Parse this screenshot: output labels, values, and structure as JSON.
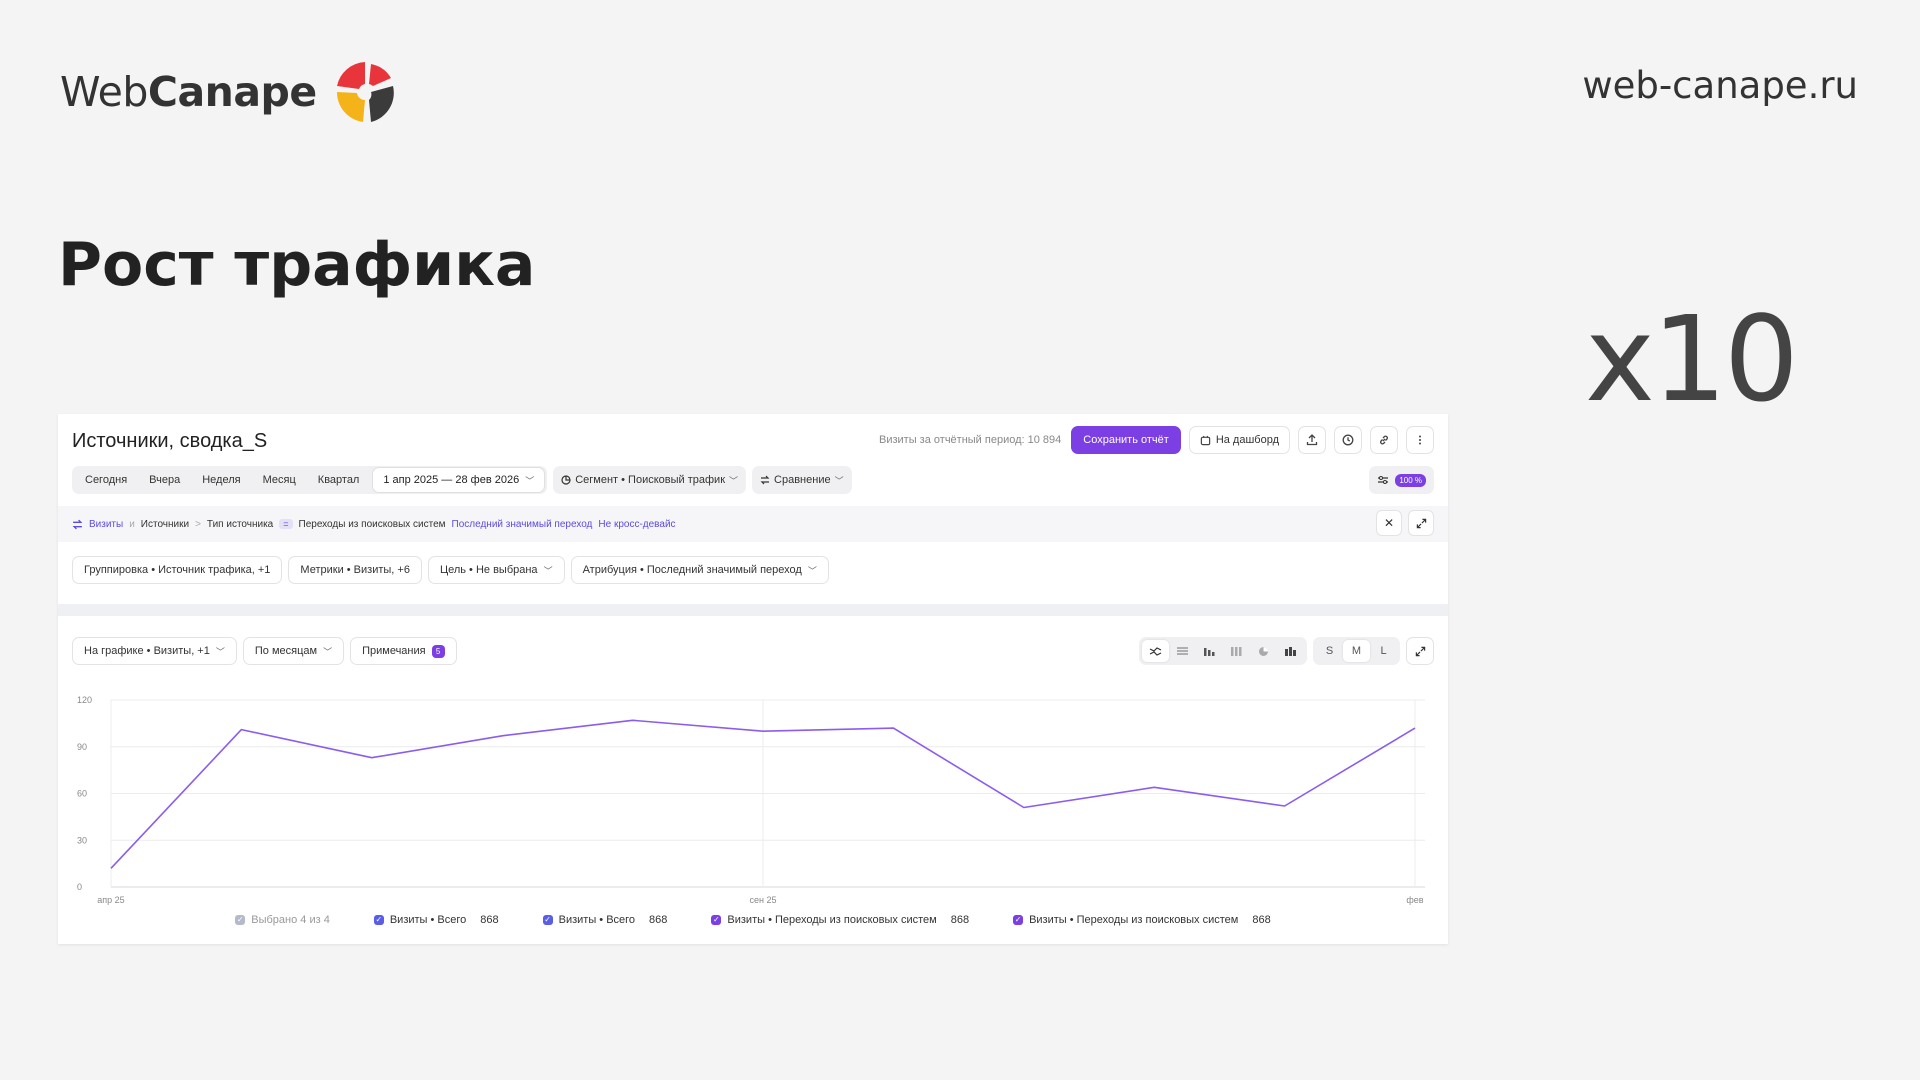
{
  "brand": {
    "name_thin": "Web",
    "name_bold": "Canape",
    "site": "web-canape.ru"
  },
  "headline": "Рост трафика",
  "multiplier": "x10",
  "report": {
    "title": "Источники, сводка_S",
    "visits_note": "Визиты за отчётный период: 10 894",
    "save_label": "Сохранить отчёт",
    "dashboard_label": "На дашборд",
    "periods": [
      "Сегодня",
      "Вчера",
      "Неделя",
      "Месяц",
      "Квартал"
    ],
    "date_range": "1 апр 2025 — 28 фев 2026",
    "segment": "Сегмент • Поисковый трафик",
    "comparison": "Сравнение",
    "sampling_badge": "100 %",
    "breadcrumb": {
      "root": "Визиты",
      "conj": "и",
      "sources": "Источники",
      "type": "Тип источника",
      "eq": "=",
      "value": "Переходы из поисковых систем",
      "attribution": "Последний значимый переход",
      "device": "Не кросс-девайс"
    },
    "filters": [
      "Группировка • Источник трафика, +1",
      "Метрики • Визиты, +6",
      "Цель • Не выбрана",
      "Атрибуция • Последний значимый переход"
    ],
    "chart_on": "На графике • Визиты, +1",
    "by_period": "По месяцам",
    "notes_label": "Примечания",
    "notes_count": "5",
    "sizes": [
      "S",
      "M",
      "L"
    ],
    "legend": {
      "selected": "Выбрано 4 из 4",
      "items": [
        {
          "label": "Визиты • Всего",
          "value": "868",
          "color": "#5a5ee6"
        },
        {
          "label": "Визиты • Всего",
          "value": "868",
          "color": "#5a5ee6"
        },
        {
          "label": "Визиты • Переходы из поисковых систем",
          "value": "868",
          "color": "#7b3fe4"
        },
        {
          "label": "Визиты • Переходы из поисковых систем",
          "value": "868",
          "color": "#7b3fe4"
        }
      ]
    }
  },
  "colors": {
    "accent": "#7b3fe4",
    "line": "#8a5cf0"
  },
  "chart_data": {
    "type": "line",
    "x": [
      "апр 25",
      "май 25",
      "июн 25",
      "июл 25",
      "авг 25",
      "сен 25",
      "окт 25",
      "ноя 25",
      "дек 25",
      "янв 26",
      "фев 26"
    ],
    "x_ticks": [
      "апр 25",
      "сен 25",
      "фев"
    ],
    "y_ticks": [
      0,
      30,
      60,
      90,
      120
    ],
    "ylim": [
      0,
      120
    ],
    "grid": true,
    "series": [
      {
        "values": [
          12,
          101,
          83,
          97,
          107,
          100,
          102,
          51,
          64,
          52,
          102
        ]
      }
    ]
  }
}
